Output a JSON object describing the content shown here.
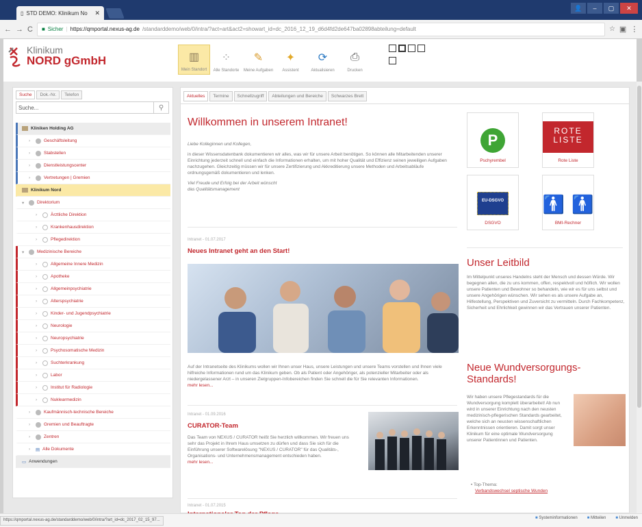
{
  "browser": {
    "tab_title": "STD DEMO: Klinikum No",
    "secure": "Sicher",
    "url_host": "https://qmportal.nexus-ag.de",
    "url_path": "/standarddemo/web/0/intra/?act=art&act2=showart_id=dc_2016_12_19_d6d4fd2de647ba02898abteilung=default"
  },
  "app": {
    "logo_line1": "Klinikum",
    "logo_line2": "NORD gGmbH",
    "tools": [
      {
        "label": "Mein Standort",
        "icon": "building-icon"
      },
      {
        "label": "Alle Standorte",
        "icon": "sites-icon"
      },
      {
        "label": "Meine Aufgaben",
        "icon": "tasks-icon"
      },
      {
        "label": "Assistent",
        "icon": "wand-icon"
      },
      {
        "label": "Aktualisieren",
        "icon": "refresh-icon"
      },
      {
        "label": "Drucken",
        "icon": "print-icon"
      }
    ]
  },
  "sidebar": {
    "tabs": [
      "Suche",
      "Dok.-Nr.",
      "Telefon"
    ],
    "search_placeholder": "Suche...",
    "tree": [
      "Kliniken Holding AG",
      "Geschäftsleitung",
      "Stabstellen",
      "Dienstleistungscenter",
      "Vertretungen | Gremien",
      "Klinikum Nord",
      "Direktorium",
      "Ärztliche Direktion",
      "Krankenhausdirektion",
      "Pflegedirektion",
      "Medizinische Bereiche",
      "Allgemeine Innere Medizin",
      "Apotheke",
      "Allgemeinpsychiatrie",
      "Alterspsychiatrie",
      "Kinder- und Jugendpsychiatrie",
      "Neurologie",
      "Neuropsychiatrie",
      "Psychosomatische Medizin",
      "Suchterkrankung",
      "Labor",
      "Institut für Radiologie",
      "Nuklearmedizin",
      "Kaufmännisch-technische Bereiche",
      "Gremien und Beauftragte",
      "Zentren",
      "Alle Dokumente",
      "Anwendungen"
    ]
  },
  "content": {
    "tabs": [
      "Aktuelles",
      "Termine",
      "Schnellzugriff",
      "Abteilungen und Bereiche",
      "Schwarzes Brett"
    ],
    "title": "Willkommen in unserem Intranet!",
    "greeting": "Liebe Kolleginnen und Kollegen,",
    "intro": "in dieser Wissensdatenbank dokumentieren wir alles, was wir für unsere Arbeit benötigen. So können alle Mitarbeitenden unserer Einrichtung jederzeit schnell und einfach die Informationen erhalten, um mit hoher Qualität und Effizienz seinen jeweiligen Aufgaben nachzugehen. Gleichzeitig müssen wir für unsere Zertifizierung und Akkreditierung unsere Methoden und Arbeitsabläufe ordnungsgemäß dokumentieren und lenken.",
    "sign1": "Viel Freude und Erfolg bei der Arbeit wünscht",
    "sign2": "das Qualitätsmanagement",
    "news": [
      {
        "meta": "Intranet - 01.07.2017",
        "title": "Neues Intranet geht an den Start!",
        "text": "Auf der Intranetseite des Klinikums wollen wir Ihnen unser Haus, unsere Leistungen und unsere Teams vorstellen und Ihnen viele hilfreiche Informationen rund um das Klinikum geben. Ob als Patient oder Angehöriger, als potenzieller Mitarbeiter oder als niedergelassener Arzt – in unseren Zielgruppen-Infobereichen finden Sie schnell die für Sie relevanten Informationen.",
        "more": "mehr lesen..."
      },
      {
        "meta": "Intranet - 01.09.2016",
        "title": "CURATOR-Team",
        "text": "Das Team von NEXUS / CURATOR heißt Sie herzlich willkommen. Wir freuen uns sehr das Projekt in Ihrem Haus umsetzen zu dürfen und dass Sie sich für die Einführung unserer Softwarelösung \"NEXUS / CURATOR\" für das Qualitäts-, Organisations- und Unternehmensmanagement entschieden haben.",
        "more": "mehr lesen..."
      },
      {
        "meta": "Intranet - 01.07.2015",
        "title": "Internationaler Tag der Pflege"
      }
    ],
    "tiles": [
      "Pschyrembel",
      "Rote Liste",
      "DSGVO",
      "BMI-Rechner"
    ],
    "rote_liste_logo": "ROTE LISTE",
    "eu_logo": "EU-DSGVO",
    "leitbild_title": "Unser Leitbild",
    "leitbild_text": "Im Mittelpunkt unseres Handelns steht der Mensch und dessen Würde. Wir begegnen allen, die zu uns kommen, offen, respektvoll und höflich. Wir wollen unsere Patienten und Bewohner so behandeln, wie wir es für uns selbst und unsere Angehörigen wünschen. Wir sehen es als unsere Aufgabe an, Hilfestellung, Perspektiven und Zuversicht zu vermitteln. Durch Fachkompetenz, Sicherheit und Ehrlichkeit gewinnen wir das Vertrauen unserer Patienten.",
    "wund_title": "Neue Wundversorgungs-Standards!",
    "wund_text": "Wir haben unsere Pflegestandards für die Wundversorgung komplett überarbeitet! Ab nun wird in unserer Einrichtung nach den neusten medizinisch-pflegerischen Standards gearbeitet, welche sich an neusten wissenschaftlichen Erkenntnissen orientieren. Damit sorgt unser Klinikum für eine optimale Wundversorgung unserer Patientinnen und Patienten.",
    "wund_bullet_label": "Top-Thema:",
    "wund_bullet_link": "Verbandswechsel septische Wunden"
  },
  "status": {
    "url": "https://qmportal.nexus-ag.de/standarddemo/web/0/intra/?art_id=dc_2017_02_15_97...",
    "items": [
      "Systeminformationen",
      "Mitteilen",
      "Unmelden"
    ]
  }
}
